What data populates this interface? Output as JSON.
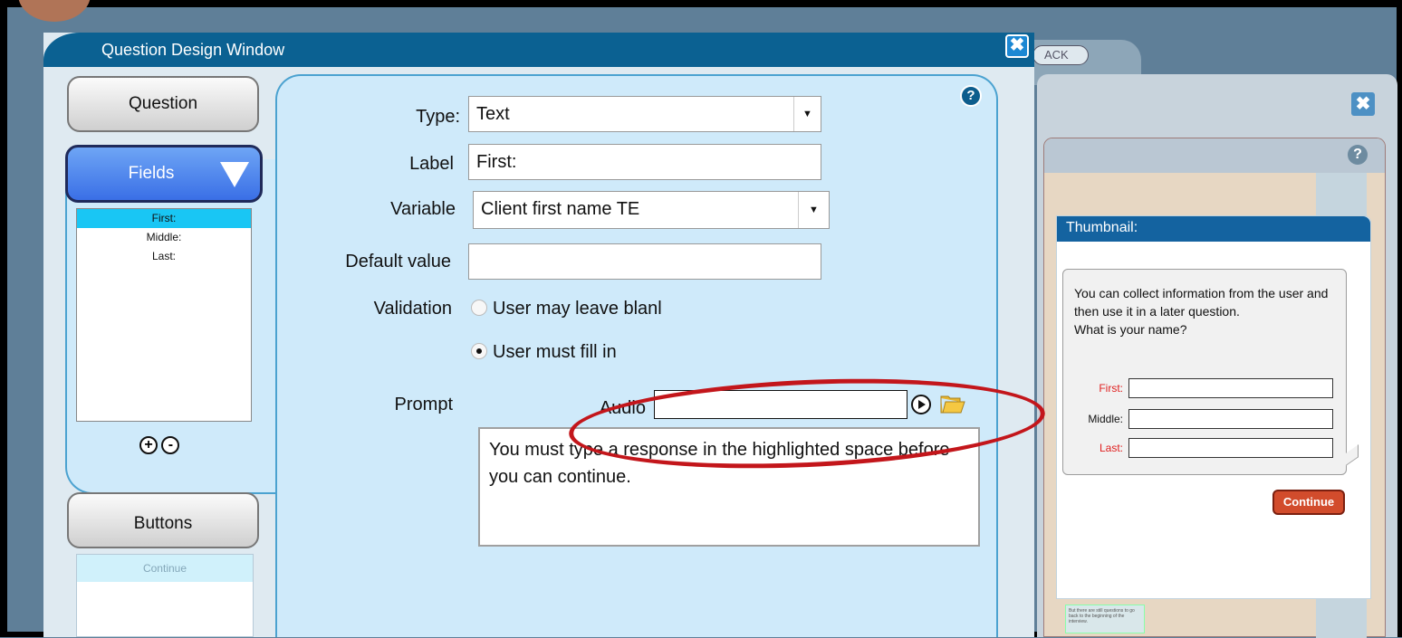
{
  "background": {
    "tab_pill_label": "ACK",
    "note_text": "But there are still questions to go back to the beginning of the interview."
  },
  "dialog": {
    "title": "Question Design Window",
    "close_symbol": "✖",
    "help_symbol": "?"
  },
  "sidebar": {
    "question_label": "Question",
    "fields_label": "Fields",
    "fields": [
      "First:",
      "Middle:",
      "Last:"
    ],
    "selected_field": "First:",
    "buttons_label": "Buttons",
    "buttons": [
      "Continue"
    ]
  },
  "form": {
    "type_label": "Type:",
    "type_value": "Text",
    "label_label": "Label",
    "label_value": "First:",
    "variable_label": "Variable",
    "variable_value": "Client first name TE",
    "default_label": "Default value",
    "default_value": "",
    "validation_label": "Validation",
    "validation_options": [
      "User may leave blanl",
      "User must fill in"
    ],
    "validation_selected": "User must fill in",
    "prompt_label": "Prompt",
    "audio_label": "Audio",
    "audio_value": "",
    "prompt_text": "You must type a response in the highlighted space before you can continue."
  },
  "thumbnail": {
    "title": "Thumbnail:",
    "text": "You can collect information from the user and then use it in a later question.\nWhat is your name?",
    "fields": [
      {
        "label": "First:",
        "required": true
      },
      {
        "label": "Middle:",
        "required": false
      },
      {
        "label": "Last:",
        "required": true
      }
    ],
    "continue_label": "Continue"
  },
  "colors": {
    "titlebar": "#0b6192",
    "required_label": "#e02020",
    "highlight_ellipse": "#c3161b",
    "selected_field": "#19c6f4"
  }
}
